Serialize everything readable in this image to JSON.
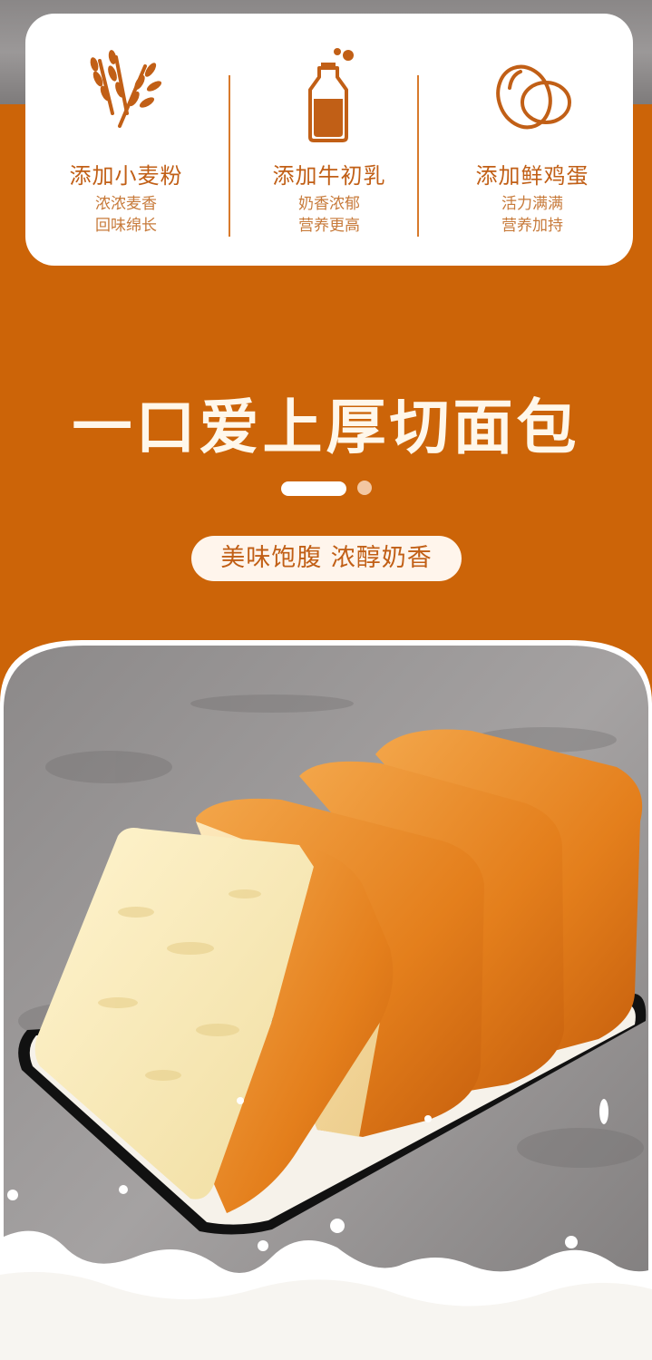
{
  "features": [
    {
      "icon": "wheat-icon",
      "title": "添加小麦粉",
      "line1": "浓浓麦香",
      "line2": "回味绵长"
    },
    {
      "icon": "milk-bottle-icon",
      "title": "添加牛初乳",
      "line1": "奶香浓郁",
      "line2": "营养更高"
    },
    {
      "icon": "egg-icon",
      "title": "添加鲜鸡蛋",
      "line1": "活力满满",
      "line2": "营养加持"
    }
  ],
  "headline": "一口爱上厚切面包",
  "tagline": "美味饱腹 浓醇奶香",
  "colors": {
    "orange": "#cc6408",
    "accent_text": "#c15f16",
    "cream": "#fff7ea"
  }
}
